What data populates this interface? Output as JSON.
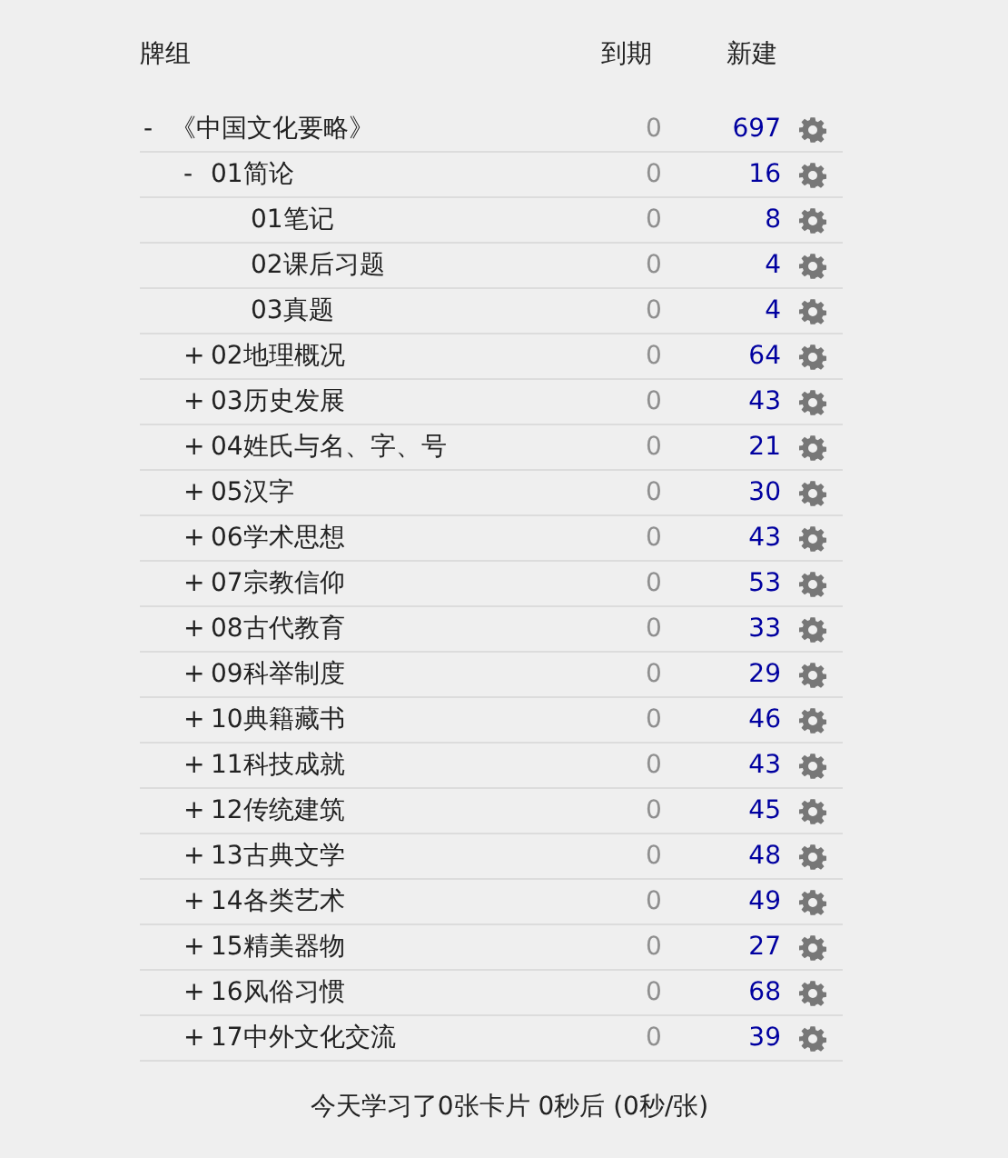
{
  "columns": {
    "deck": "牌组",
    "due": "到期",
    "new": "新建"
  },
  "decks": [
    {
      "name": "《中国文化要略》",
      "expander": "-",
      "due": "0",
      "new": "697",
      "children": [
        {
          "name": "01简论",
          "expander": "-",
          "due": "0",
          "new": "16",
          "children": [
            {
              "name": "01笔记",
              "due": "0",
              "new": "8"
            },
            {
              "name": "02课后习题",
              "due": "0",
              "new": "4"
            },
            {
              "name": "03真题",
              "due": "0",
              "new": "4"
            }
          ]
        },
        {
          "name": "02地理概况",
          "expander": "+",
          "due": "0",
          "new": "64"
        },
        {
          "name": "03历史发展",
          "expander": "+",
          "due": "0",
          "new": "43"
        },
        {
          "name": "04姓氏与名、字、号",
          "expander": "+",
          "due": "0",
          "new": "21"
        },
        {
          "name": "05汉字",
          "expander": "+",
          "due": "0",
          "new": "30"
        },
        {
          "name": "06学术思想",
          "expander": "+",
          "due": "0",
          "new": "43"
        },
        {
          "name": "07宗教信仰",
          "expander": "+",
          "due": "0",
          "new": "53"
        },
        {
          "name": "08古代教育",
          "expander": "+",
          "due": "0",
          "new": "33"
        },
        {
          "name": "09科举制度",
          "expander": "+",
          "due": "0",
          "new": "29"
        },
        {
          "name": "10典籍藏书",
          "expander": "+",
          "due": "0",
          "new": "46"
        },
        {
          "name": "11科技成就",
          "expander": "+",
          "due": "0",
          "new": "43"
        },
        {
          "name": "12传统建筑",
          "expander": "+",
          "due": "0",
          "new": "45"
        },
        {
          "name": "13古典文学",
          "expander": "+",
          "due": "0",
          "new": "48"
        },
        {
          "name": "14各类艺术",
          "expander": "+",
          "due": "0",
          "new": "49"
        },
        {
          "name": "15精美器物",
          "expander": "+",
          "due": "0",
          "new": "27"
        },
        {
          "name": "16风俗习惯",
          "expander": "+",
          "due": "0",
          "new": "68"
        },
        {
          "name": "17中外文化交流",
          "expander": "+",
          "due": "0",
          "new": "39"
        }
      ]
    }
  ],
  "footer": "今天学习了0张卡片 0秒后 (0秒/张)"
}
